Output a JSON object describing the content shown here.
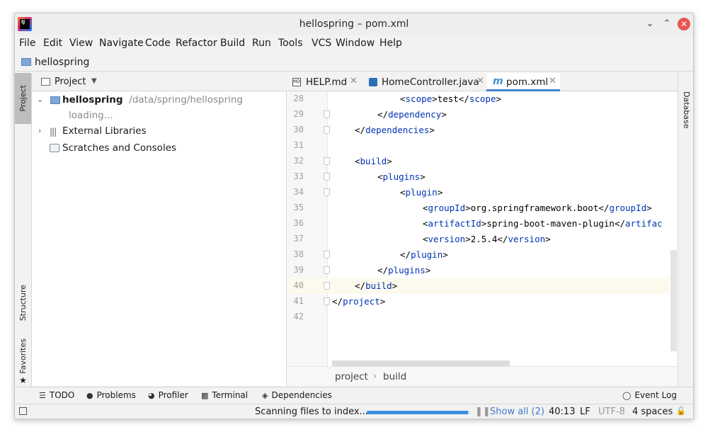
{
  "window": {
    "title": "hellospring – pom.xml",
    "app_logo": "IJ"
  },
  "menu": [
    "File",
    "Edit",
    "View",
    "Navigate",
    "Code",
    "Refactor",
    "Build",
    "Run",
    "Tools",
    "VCS",
    "Window",
    "Help"
  ],
  "navbar": {
    "project": "hellospring",
    "icon": "folder-icon"
  },
  "left_strip": {
    "project": "Project",
    "structure": "Structure",
    "favorites": "Favorites"
  },
  "project_panel": {
    "title": "Project",
    "tree": [
      {
        "label": "hellospring",
        "path": "/data/spring/hellospring",
        "expanded": true
      },
      {
        "label": "loading..."
      },
      {
        "label": "External Libraries",
        "expanded": false
      },
      {
        "label": "Scratches and Consoles"
      }
    ]
  },
  "editor": {
    "tabs": [
      {
        "label": "HELP.md",
        "icon": "markdown-icon"
      },
      {
        "label": "HomeController.java",
        "icon": "java-icon"
      },
      {
        "label": "pom.xml",
        "icon": "maven-icon",
        "active": true
      }
    ],
    "lines": [
      {
        "no": "28",
        "indent": 12,
        "parts": [
          [
            "<",
            "t"
          ],
          [
            "scope",
            "g"
          ],
          [
            ">test</",
            "t"
          ],
          [
            "scope",
            "g"
          ],
          [
            ">",
            "t"
          ]
        ]
      },
      {
        "no": "29",
        "indent": 8,
        "parts": [
          [
            "</",
            "t"
          ],
          [
            "dependency",
            "g"
          ],
          [
            ">",
            "t"
          ]
        ]
      },
      {
        "no": "30",
        "indent": 4,
        "parts": [
          [
            "</",
            "t"
          ],
          [
            "dependencies",
            "g"
          ],
          [
            ">",
            "t"
          ]
        ]
      },
      {
        "no": "31",
        "indent": 0,
        "parts": []
      },
      {
        "no": "32",
        "indent": 4,
        "parts": [
          [
            "<",
            "t"
          ],
          [
            "build",
            "g"
          ],
          [
            ">",
            "t"
          ]
        ]
      },
      {
        "no": "33",
        "indent": 8,
        "parts": [
          [
            "<",
            "t"
          ],
          [
            "plugins",
            "g"
          ],
          [
            ">",
            "t"
          ]
        ]
      },
      {
        "no": "34",
        "indent": 12,
        "parts": [
          [
            "<",
            "t"
          ],
          [
            "plugin",
            "g"
          ],
          [
            ">",
            "t"
          ]
        ]
      },
      {
        "no": "35",
        "indent": 16,
        "parts": [
          [
            "<",
            "t"
          ],
          [
            "groupId",
            "g"
          ],
          [
            ">org.springframework.boot</",
            "t"
          ],
          [
            "groupId",
            "g"
          ],
          [
            ">",
            "t"
          ]
        ]
      },
      {
        "no": "36",
        "indent": 16,
        "parts": [
          [
            "<",
            "t"
          ],
          [
            "artifactId",
            "g"
          ],
          [
            ">spring-boot-maven-plugin</",
            "t"
          ],
          [
            "artifac",
            "g"
          ]
        ]
      },
      {
        "no": "37",
        "indent": 16,
        "parts": [
          [
            "<",
            "t"
          ],
          [
            "version",
            "g"
          ],
          [
            ">2.5.4</",
            "t"
          ],
          [
            "version",
            "g"
          ],
          [
            ">",
            "t"
          ]
        ]
      },
      {
        "no": "38",
        "indent": 12,
        "parts": [
          [
            "</",
            "t"
          ],
          [
            "plugin",
            "g"
          ],
          [
            ">",
            "t"
          ]
        ]
      },
      {
        "no": "39",
        "indent": 8,
        "parts": [
          [
            "</",
            "t"
          ],
          [
            "plugins",
            "g"
          ],
          [
            ">",
            "t"
          ]
        ]
      },
      {
        "no": "40",
        "indent": 4,
        "parts": [
          [
            "</",
            "t"
          ],
          [
            "build",
            "g"
          ],
          [
            ">",
            "t"
          ]
        ],
        "current": true
      },
      {
        "no": "41",
        "indent": 0,
        "parts": [
          [
            "</",
            "t"
          ],
          [
            "project",
            "g"
          ],
          [
            ">",
            "t"
          ]
        ]
      },
      {
        "no": "42",
        "indent": 0,
        "parts": []
      }
    ],
    "breadcrumbs": [
      "project",
      "build"
    ]
  },
  "right_strip": {
    "database": "Database"
  },
  "bottom_tools": [
    {
      "label": "TODO",
      "icon": "list-icon"
    },
    {
      "label": "Problems",
      "icon": "problems-icon"
    },
    {
      "label": "Profiler",
      "icon": "profiler-icon"
    },
    {
      "label": "Terminal",
      "icon": "terminal-icon"
    },
    {
      "label": "Dependencies",
      "icon": "dependencies-icon"
    }
  ],
  "event_log": "Event Log",
  "status": {
    "task": "Scanning files to index...",
    "progress": 0.98,
    "show_all": "Show all (2)",
    "position": "40:13",
    "line_sep": "LF",
    "encoding": "UTF-8",
    "indent": "4 spaces"
  },
  "colors": {
    "tag": "#0033b3",
    "accent": "#4083c9",
    "current_line": "#fcfaed"
  }
}
